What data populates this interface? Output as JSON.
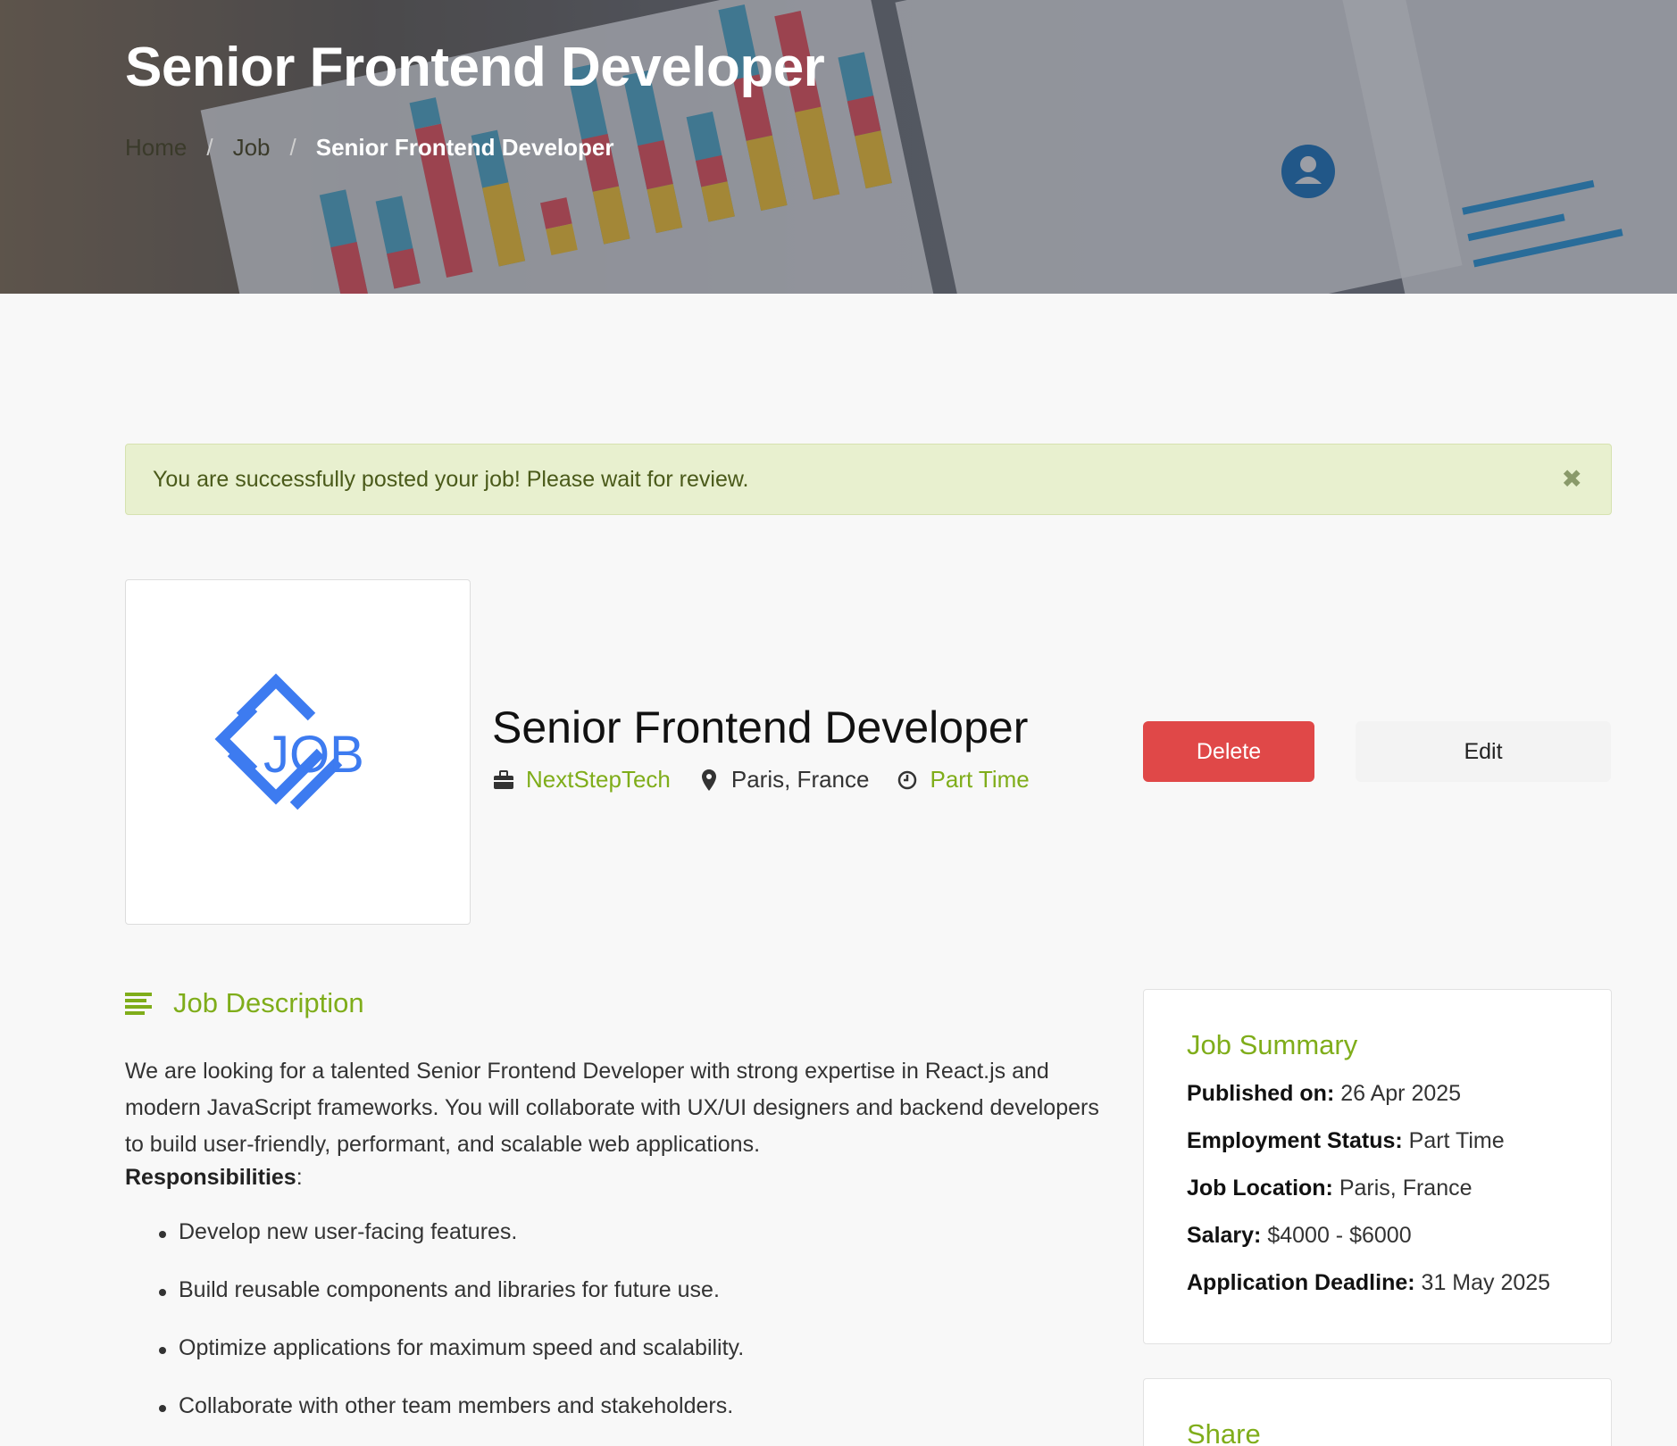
{
  "hero": {
    "title": "Senior Frontend Developer",
    "breadcrumb": [
      "Home",
      "Job",
      "Senior Frontend Developer"
    ]
  },
  "alert": {
    "message": "You are successfully posted your job! Please wait for review.",
    "close_glyph": "✖"
  },
  "job": {
    "logo_text": "JOB",
    "title": "Senior Frontend Developer",
    "company": "NextStepTech",
    "location": "Paris, France",
    "type": "Part Time",
    "delete_label": "Delete",
    "edit_label": "Edit"
  },
  "description": {
    "heading": "Job Description",
    "paragraph": "We are looking for a talented Senior Frontend Developer with strong expertise in React.js and modern JavaScript frameworks. You will collaborate with UX/UI designers and backend developers to build user-friendly, performant, and scalable web applications.",
    "responsibilities_label": "Responsibilities",
    "responsibilities": [
      "Develop new user-facing features.",
      "Build reusable components and libraries for future use.",
      "Optimize applications for maximum speed and scalability.",
      "Collaborate with other team members and stakeholders."
    ]
  },
  "summary": {
    "heading": "Job Summary",
    "rows": [
      {
        "label": "Published on:",
        "value": "26 Apr 2025"
      },
      {
        "label": "Employment Status:",
        "value": "Part Time"
      },
      {
        "label": "Job Location:",
        "value": "Paris, France"
      },
      {
        "label": "Salary:",
        "value": "$4000 - $6000"
      },
      {
        "label": "Application Deadline:",
        "value": "31 May 2025"
      }
    ]
  },
  "share": {
    "heading": "Share"
  },
  "colors": {
    "accent": "#7fad1a",
    "danger": "#e04848",
    "logo_blue": "#3d7bf0",
    "alert_bg": "#e8f0cf"
  },
  "icons": [
    "briefcase-icon",
    "map-pin-icon",
    "clock-icon",
    "list-lines-icon",
    "close-icon"
  ]
}
